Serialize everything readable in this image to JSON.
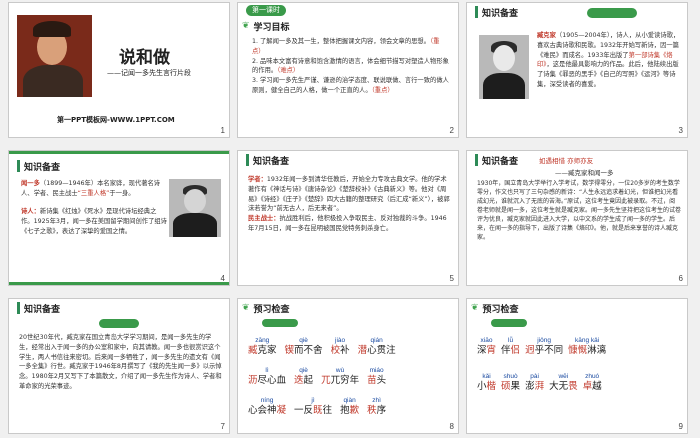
{
  "slides": [
    {
      "number": "1",
      "title": "说和做",
      "subtitle": "——记闻一多先生言行片段",
      "footer": "第一PPT模板网-WWW.1PPT.COM"
    },
    {
      "number": "2",
      "badge": "第一课时",
      "header": "学习目标",
      "goals": [
        "1. 了解闻一多及其一生，整体把握课文内容，领会文章的思想。",
        "（重点）",
        "2. 品味本文富有诗意和饱含激情的语言，体会细节描写对塑造人物形象的作用。",
        "（难点）",
        "3. 学习闻一多先生严谨、谦逊的治学态度、联说联做、言行一致的做人原则，健全自己的人格，做一个正直的人。",
        "（重点）"
      ]
    },
    {
      "number": "3",
      "header": "知识备查",
      "person_name": "臧克家",
      "bio_a": "（1905—2004年），诗人，从小爱读诗歌，喜欢古典诗歌和民歌。1932年开始写新诗，因一篇《难民》而成名。1933年出版了",
      "bio_first": "第一部诗集《烙印》",
      "bio_b": "，这是他最具影响力的作品。此后，他陆续出版了诗集《罪恶的黑手》《自己的写照》《运河》等诗集，深受读者的喜爱。"
    },
    {
      "number": "4",
      "header": "知识备查",
      "person_name": "闻一多",
      "bio_a": "（1899—1946年）本名家骅，现代著名诗人、学者、民主战士",
      "bio_a_hl": "“三重人格”",
      "bio_a2": "于一身。",
      "label_poet": "诗人：",
      "bio_b": "新诗集《红烛》《死水》是现代诗坛经典之作。1925年3月，闻一多在美国留学期间创作了组诗《七子之歌》，表达了深挚的爱国之情。"
    },
    {
      "number": "5",
      "header": "知识备查",
      "label_scholar": "学者：",
      "para1": "1932年闻一多到清华任教后，开始全力专攻古典文学。他的学术著作有《神话与诗》《唐诗杂论》《楚辞校补》《古典新义》等。他对《周易》《诗经》《庄子》《楚辞》四大古籍的整理研究（后汇成“新义”），被郭沫若誉为“前无古人，后无来者”。",
      "label_fighter": "民主战士：",
      "para2": "抗战胜利后，他积极投入争取民主、反对独裁的斗争。1946年7月15日，闻一多在昆明被国民党特务刺杀身亡。"
    },
    {
      "number": "6",
      "header": "知识备查",
      "top_tag": "如遇相惜 亦师亦友",
      "subhead": "——臧克家和闻一多",
      "para": "1930年，国立青岛大学举行入学考试，数学得零分，一位20多岁的考生数学零分，作文也只写了三句杂感的新诗：“人生永远追求着幻光，但谁把幻光看成幻光，谁就沉入了无底的苦海。”原试，这位考生竟因此被录取。不过，阅卷老师就是闻一多，这位考生就是臧克家。闻一多先生坚持把这位考生的试卷评为优良，臧克家就因此进入大学，以中文系的学生成了闻一多的学生。后来，在闻一多的指导下，出版了诗集《烙印》。他，就是后来享誉的诗人臧克家。"
    },
    {
      "number": "7",
      "header": "知识备查",
      "para": "20世纪30年代，臧克家在国立青岛大学学习期间，是闻一多先生的学生，经常出入于闻一多的办公室和家中，向其请教。闻一多也很赏识这个学生，两人书信往来密切。后来闻一多牺牲了，闻一多先生的遗文有《闻一多全集》行世。臧克家于1946年8月撰写了《我的先生闻一多》以示悼念。1980年2月又写下了本篇散文，介绍了闻一多先生作为诗人、学者和革命家的光荣事迹。"
    },
    {
      "number": "8",
      "header": "预习检查",
      "words": [
        [
          {
            "p": "zāng",
            "w": "臧克家",
            "hl": "臧"
          },
          {
            "p": "qiè",
            "w": "锲而不舍",
            "hl": "锲"
          },
          {
            "p": "jiào",
            "w": "校补",
            "hl": "校"
          },
          {
            "p": "qián",
            "w": "潜心贯注",
            "hl": "潜"
          }
        ],
        [
          {
            "p": "lì",
            "w": "沥尽心血",
            "hl": "沥"
          },
          {
            "p": "qiè",
            "w": "迭起",
            "hl": "迭"
          },
          {
            "p": "wù",
            "w": "兀兀穷年",
            "hl": "兀"
          },
          {
            "p": "miáo",
            "w": "苗头",
            "hl": "苗"
          }
        ],
        [
          {
            "p": "níng",
            "w": "心会神凝",
            "hl": "凝"
          },
          {
            "p": "jì",
            "w": "一反既往",
            "hl": "既"
          },
          {
            "p": "qiàn",
            "w": "抱歉",
            "hl": "歉"
          },
          {
            "p": "zhì",
            "w": "秩序",
            "hl": "秩"
          }
        ]
      ]
    },
    {
      "number": "9",
      "header": "预习检查",
      "words": [
        [
          {
            "p": "xiāo",
            "w": "深宵",
            "hl": "宵"
          },
          {
            "p": "lǚ",
            "w": "伴侣",
            "hl": "侣"
          },
          {
            "p": "jiǒng",
            "w": "迥乎不同",
            "hl": "迥"
          },
          {
            "p": "kāng kǎi",
            "w": "慷慨淋漓",
            "hl": "慷慨"
          }
        ],
        [
          {
            "p": "kǎi",
            "w": "小楷",
            "hl": "楷"
          },
          {
            "p": "shuò",
            "w": "硕果",
            "hl": "硕"
          },
          {
            "p": "pài",
            "w": "澎湃",
            "hl": "湃"
          },
          {
            "p": "wēi",
            "w": "大无畏",
            "hl": "畏"
          },
          {
            "p": "zhuó",
            "w": "卓越",
            "hl": "卓"
          }
        ]
      ]
    }
  ]
}
